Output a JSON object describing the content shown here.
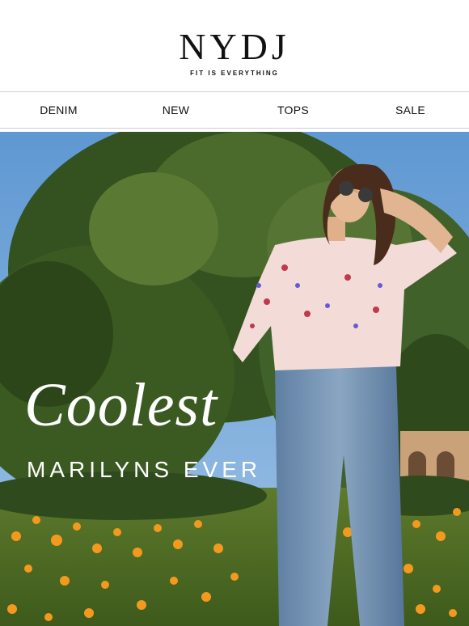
{
  "brand": {
    "logo": "NYDJ",
    "tagline": "FIT IS EVERYTHING"
  },
  "nav": {
    "items": [
      "DENIM",
      "NEW",
      "TOPS",
      "SALE"
    ]
  },
  "hero": {
    "headline": "Coolest",
    "subline": "MARILYNS EVER",
    "image": "woman-in-floral-blouse-and-jeans-photo"
  },
  "colors": {
    "sky": "#6fa6d8",
    "foliage": "#2f4a1f",
    "flowers": "#f39a1e",
    "text": "#111111"
  }
}
